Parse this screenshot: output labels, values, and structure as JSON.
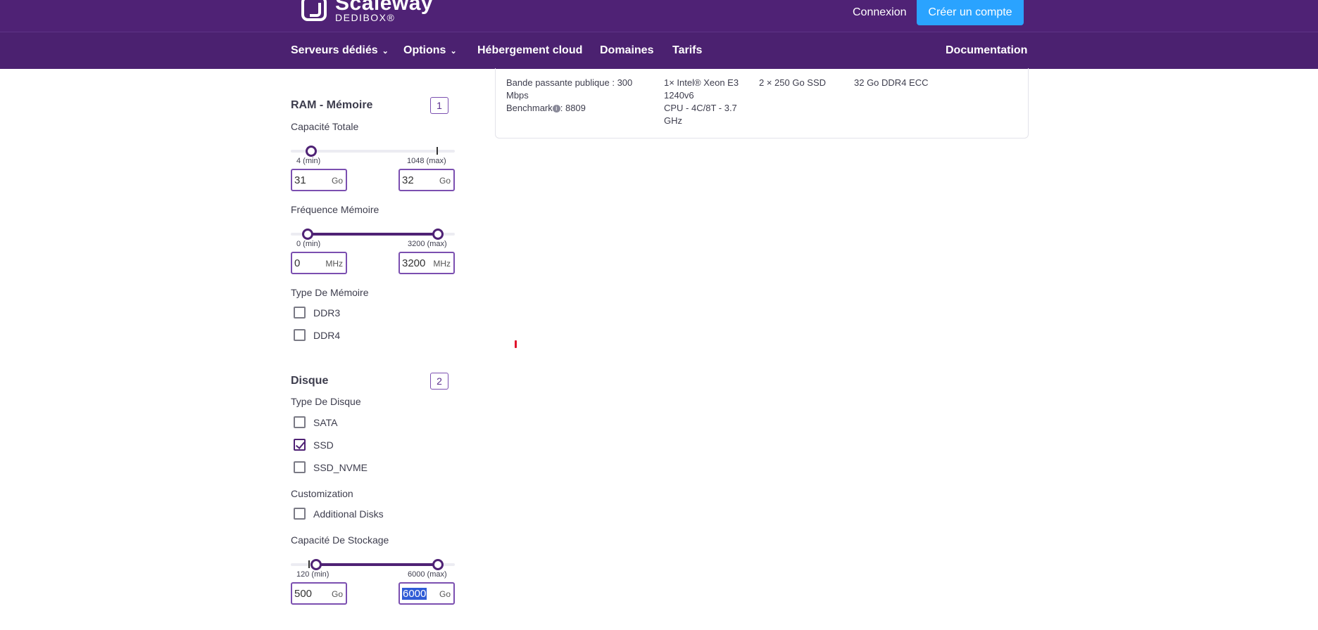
{
  "header": {
    "logo_name": "Scaleway",
    "logo_sub": "DEDIBOX®",
    "login": "Connexion",
    "signup": "Créer un compte"
  },
  "nav": {
    "items": [
      {
        "label": "Serveurs dédiés",
        "has_dropdown": true
      },
      {
        "label": "Options",
        "has_dropdown": true
      },
      {
        "label": "Hébergement cloud",
        "has_dropdown": false
      },
      {
        "label": "Domaines",
        "has_dropdown": false
      },
      {
        "label": "Tarifs",
        "has_dropdown": false
      }
    ],
    "documentation": "Documentation"
  },
  "server_card": {
    "bandwidth_line1": "Bande passante publique : 300",
    "bandwidth_line2": "Mbps",
    "benchmark_label": "Benchmark",
    "benchmark_value": ": 8809",
    "cpu_line1": "1× Intel® Xeon E3",
    "cpu_line2": "1240v6",
    "cpu_line3": "CPU - 4C/8T - 3.7",
    "cpu_line4": "GHz",
    "disk": "2 × 250 Go SSD",
    "ram": "32 Go DDR4 ECC"
  },
  "filters": {
    "ram": {
      "title": "RAM - Mémoire",
      "badge": "1",
      "capacity": {
        "label": "Capacité Totale",
        "min_label": "4 (min)",
        "max_label": "1048 (max)",
        "min_value": "31",
        "max_value": "32",
        "unit": "Go"
      },
      "frequency": {
        "label": "Fréquence Mémoire",
        "min_label": "0 (min)",
        "max_label": "3200 (max)",
        "min_value": "0",
        "max_value": "3200",
        "unit": "MHz"
      },
      "type": {
        "label": "Type De Mémoire",
        "options": [
          {
            "label": "DDR3",
            "checked": false
          },
          {
            "label": "DDR4",
            "checked": false
          }
        ]
      }
    },
    "disk": {
      "title": "Disque",
      "badge": "2",
      "type": {
        "label": "Type De Disque",
        "options": [
          {
            "label": "SATA",
            "checked": false
          },
          {
            "label": "SSD",
            "checked": true
          },
          {
            "label": "SSD_NVME",
            "checked": false
          }
        ]
      },
      "customization": {
        "label": "Customization",
        "options": [
          {
            "label": "Additional Disks",
            "checked": false
          }
        ]
      },
      "storage": {
        "label": "Capacité De Stockage",
        "min_label": "120 (min)",
        "max_label": "6000 (max)",
        "min_value": "500",
        "max_value": "6000",
        "unit": "Go"
      }
    }
  },
  "colors": {
    "brand_purple": "#4f2275",
    "accent_blue": "#2aa3ff"
  }
}
